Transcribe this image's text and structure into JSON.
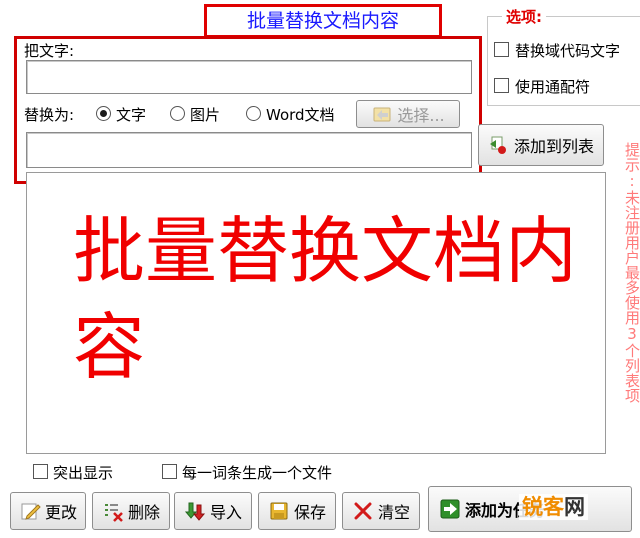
{
  "title": "批量替换文档内容",
  "form": {
    "find_label": "把文字:",
    "find_value": "",
    "replace_label": "替换为:",
    "replace_value": "",
    "types": [
      {
        "label": "文字",
        "checked": true
      },
      {
        "label": "图片",
        "checked": false
      },
      {
        "label": "Word文档",
        "checked": false
      }
    ],
    "select_button": "选择...",
    "add_to_list_button": "添加到列表"
  },
  "options": {
    "label": "选项:",
    "items": [
      {
        "label": "替换域代码文字",
        "checked": false
      },
      {
        "label": "使用通配符",
        "checked": false
      }
    ]
  },
  "tip": "提示:未注册用户最多使用3个列表项",
  "list": {
    "overlay_text": "批量替换文档内容"
  },
  "bottom_options": [
    {
      "label": "突出显示",
      "checked": false
    },
    {
      "label": "每一词条生成一个文件",
      "checked": false
    }
  ],
  "toolbar": {
    "edit": "更改",
    "delete": "删除",
    "import": "导入",
    "save": "保存",
    "clear": "清空",
    "add_task": "添加为任务"
  },
  "watermark": {
    "part1": "锐客",
    "part2": "网"
  },
  "colors": {
    "title_text": "#1a1aff",
    "highlight_border": "#e00000",
    "overlay_text": "#f00000",
    "tip_text": "#ff7a7a"
  }
}
